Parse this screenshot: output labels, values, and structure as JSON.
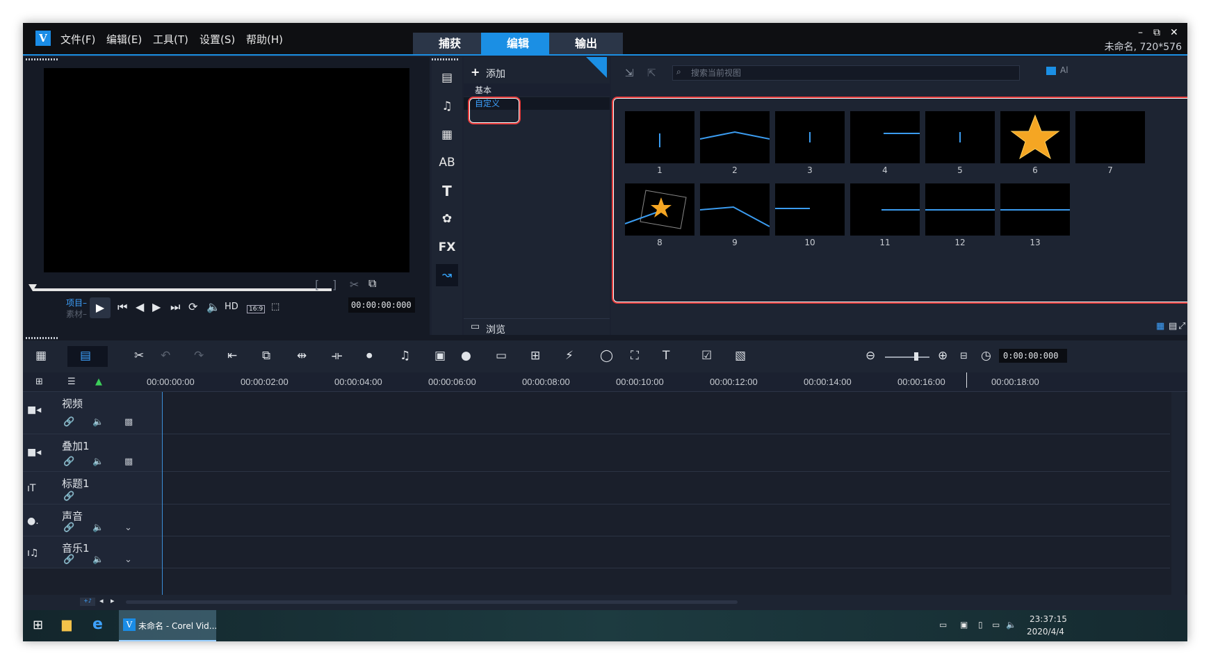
{
  "menu": {
    "file": "文件(F)",
    "edit": "编辑(E)",
    "tools": "工具(T)",
    "settings": "设置(S)",
    "help": "帮助(H)"
  },
  "tabs": {
    "capture": "捕获",
    "edit": "编辑",
    "output": "输出"
  },
  "window": {
    "info": "未命名, 720*576",
    "minimize": "–",
    "restore": "⧉",
    "close": "✕"
  },
  "preview": {
    "project_label": "项目–",
    "clip_label": "素材–",
    "hd": "HD",
    "aspect": "16:9",
    "timecode": "00:00:00:000"
  },
  "library": {
    "add": "添加",
    "categories": [
      "基本",
      "自定义"
    ],
    "browse": "浏览",
    "search_placeholder": "搜索当前视图",
    "all_label": "Al",
    "thumb_labels": [
      "1",
      "2",
      "3",
      "4",
      "5",
      "6",
      "7",
      "8",
      "9",
      "10",
      "11",
      "12",
      "13"
    ]
  },
  "timeline": {
    "timecode": "0:00:00:000",
    "ruler": [
      "00:00:00:00",
      "00:00:02:00",
      "00:00:04:00",
      "00:00:06:00",
      "00:00:08:00",
      "00:00:10:00",
      "00:00:12:00",
      "00:00:14:00",
      "00:00:16:00",
      "00:00:18:00"
    ],
    "tracks": [
      "视频",
      "叠加1",
      "标题1",
      "声音",
      "音乐1"
    ]
  },
  "taskbar": {
    "app_label": "未命名 - Corel Vid...",
    "time": "23:37:15",
    "date": "2020/4/4"
  },
  "colors": {
    "accent": "#1b8fe4",
    "highlight": "#e53a3a",
    "star": "#f5a623"
  }
}
